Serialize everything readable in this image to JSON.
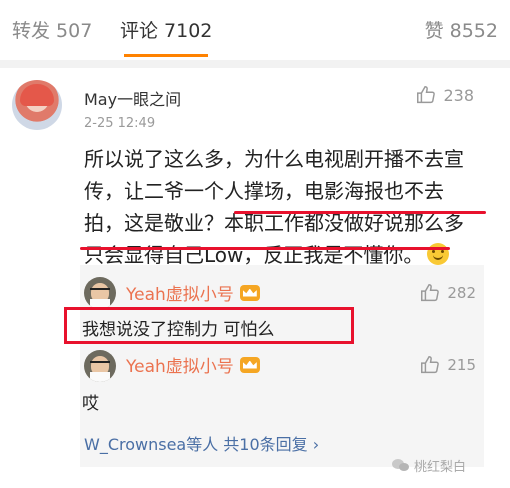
{
  "tabs": {
    "repost": "转发 507",
    "comment": "评论 7102",
    "like": "赞 8552",
    "active": "comment",
    "accent_color": "#ff8200"
  },
  "main_comment": {
    "username": "May一眼之间",
    "time": "2-25 12:49",
    "likes": "238",
    "text_lines": [
      "所以说了这么多，为什么电视剧开播不去宣",
      "传，让二爷一个人撑场，电影海报也不去",
      "拍，这是敬业？本职工作都没做好说那么多",
      "只会显得自己Low，反正我是不懂你。"
    ],
    "emoji": "smile-emoji"
  },
  "replies": [
    {
      "username": "Yeah虚拟小号",
      "likes": "282",
      "text": "我想说没了控制力 可怕么",
      "badge": "crown-badge-icon"
    },
    {
      "username": "Yeah虚拟小号",
      "likes": "215",
      "text": "哎",
      "badge": "crown-badge-icon"
    }
  ],
  "more_replies": "W_Crownsea等人 共10条回复 ›",
  "watermark": "桃红梨白",
  "highlight_color": "#e8112d",
  "link_color": "#4a6fa5",
  "username_color": "#eb7350"
}
